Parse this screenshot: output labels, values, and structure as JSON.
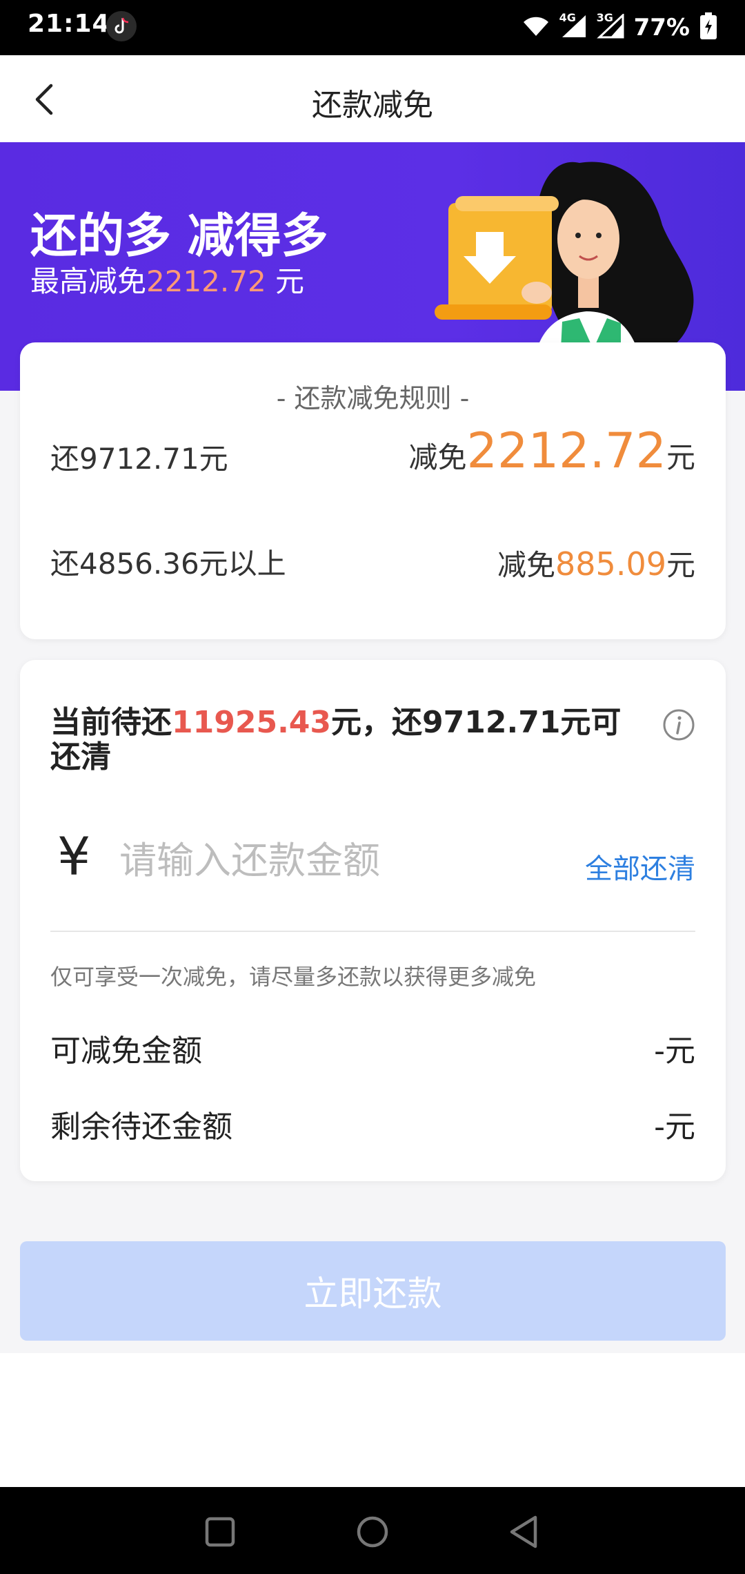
{
  "status_bar": {
    "time": "21:14",
    "network_1": "4G",
    "network_2": "3G",
    "battery": "77%"
  },
  "nav": {
    "title": "还款减免"
  },
  "banner": {
    "headline": "还的多 减得多",
    "sub_prefix": "最高减免",
    "sub_amount": "2212.72",
    "sub_suffix": " 元"
  },
  "rules": {
    "title": "- 还款减免规则 -",
    "rows": [
      {
        "left": "还9712.71元",
        "right_prefix": "减免",
        "right_amount": "2212.72",
        "right_suffix": "元"
      },
      {
        "left": "还4856.36元以上",
        "right_prefix": "减免",
        "right_amount": "885.09",
        "right_suffix": "元"
      }
    ]
  },
  "repay": {
    "headline_prefix": "当前待还",
    "headline_amount": "11925.43",
    "headline_suffix": "元，还9712.71元可还清",
    "currency": "¥",
    "input_placeholder": "请输入还款金额",
    "input_value": "",
    "pay_all_label": "全部还清",
    "notice": "仅可享受一次减免，请尽量多还款以获得更多减免",
    "details": [
      {
        "label": "可减免金额",
        "value": "-元"
      },
      {
        "label": "剩余待还金额",
        "value": "-元"
      }
    ]
  },
  "button": {
    "label": "立即还款"
  },
  "colors": {
    "banner": "#5a2be2",
    "orange": "#f08c3c",
    "red": "#e8584f",
    "link": "#2d7fe0",
    "button_disabled": "#c5d6fb"
  },
  "icons": {
    "back": "chevron-left",
    "info": "info-circle",
    "yen": "yen-sign"
  }
}
